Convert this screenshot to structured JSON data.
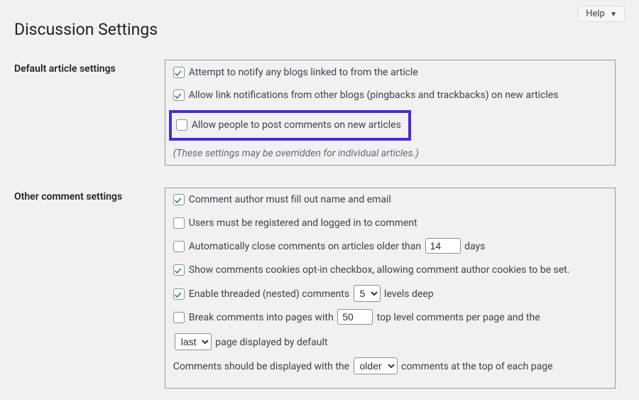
{
  "toolbar": {
    "help_label": "Help"
  },
  "page_title": "Discussion Settings",
  "sections": {
    "default_article": {
      "heading": "Default article settings",
      "notify_label": "Attempt to notify any blogs linked to from the article",
      "allow_pingbacks_label": "Allow link notifications from other blogs (pingbacks and trackbacks) on new articles",
      "allow_comments_label": "Allow people to post comments on new articles",
      "note": "(These settings may be overridden for individual articles.)"
    },
    "other_comment": {
      "heading": "Other comment settings",
      "require_name_email_label": "Comment author must fill out name and email",
      "require_registered_label": "Users must be registered and logged in to comment",
      "auto_close_pre": "Automatically close comments on articles older than ",
      "auto_close_value": "14",
      "auto_close_post": " days",
      "show_cookies_label": "Show comments cookies opt-in checkbox, allowing comment author cookies to be set.",
      "threaded_pre": "Enable threaded (nested) comments ",
      "threaded_value": "5",
      "threaded_post": " levels deep",
      "paginate_pre": "Break comments into pages with ",
      "paginate_value": "50",
      "paginate_mid": " top level comments per page and the ",
      "paginate_page_value": "last",
      "paginate_page_post": " page displayed by default",
      "order_pre": "Comments should be displayed with the ",
      "order_value": "older",
      "order_post": " comments at the top of each page"
    }
  }
}
